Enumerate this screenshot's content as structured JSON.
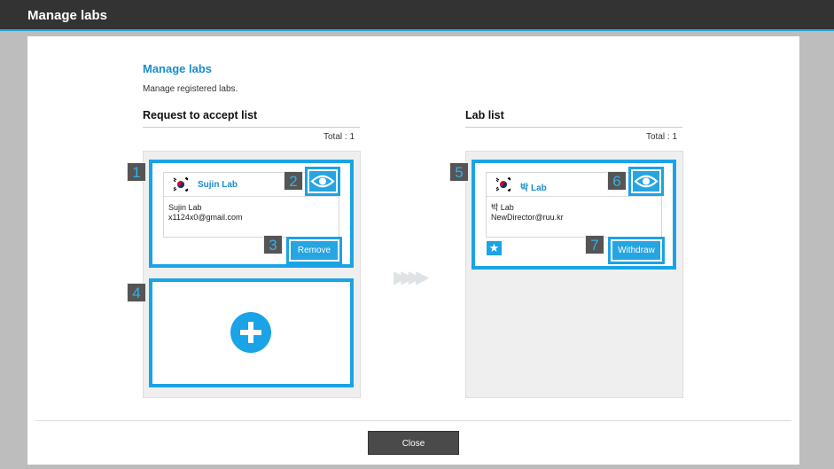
{
  "window": {
    "title": "Manage labs"
  },
  "header": {
    "title": "Manage labs",
    "description": "Manage registered labs."
  },
  "request_list": {
    "title": "Request to accept list",
    "total": "Total : 1",
    "card": {
      "lab_name": "Sujin Lab",
      "line1": "Sujin Lab",
      "line2": "x1124x0@gmail.com",
      "button": "Remove"
    }
  },
  "lab_list": {
    "title": "Lab list",
    "total": "Total : 1",
    "card": {
      "lab_name": "박 Lab",
      "line1": "박 Lab",
      "line2": "NewDirector@ruu.kr",
      "button": "Withdraw"
    }
  },
  "markers": [
    "1",
    "2",
    "3",
    "4",
    "5",
    "6",
    "7"
  ],
  "icons": {
    "view": "eye-icon",
    "add": "plus-circle-icon",
    "favorite": "star-icon",
    "flag": "korea-flag-icon",
    "transfer": "arrow-right-icon"
  },
  "colors": {
    "accent": "#1aa3e6",
    "titlebar": "#333333",
    "close_button": "#4a4a4a"
  },
  "footer": {
    "close_label": "Close"
  }
}
